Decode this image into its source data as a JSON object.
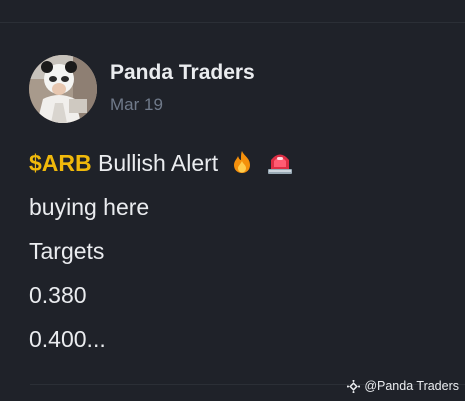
{
  "post": {
    "author": "Panda Traders",
    "date": "Mar 19",
    "ticker": "$ARB",
    "line1_rest": "Bullish Alert",
    "line2": "buying here",
    "line3": "Targets",
    "line4": "0.380",
    "line5": "0.400..."
  },
  "watermark": {
    "text": "@Panda Traders"
  },
  "icons": {
    "fire": "fire-icon",
    "siren": "siren-icon",
    "brand": "binance-logo-icon"
  },
  "colors": {
    "background": "#1f2229",
    "text": "#eaecef",
    "muted": "#707a8a",
    "ticker": "#f0b90b"
  }
}
